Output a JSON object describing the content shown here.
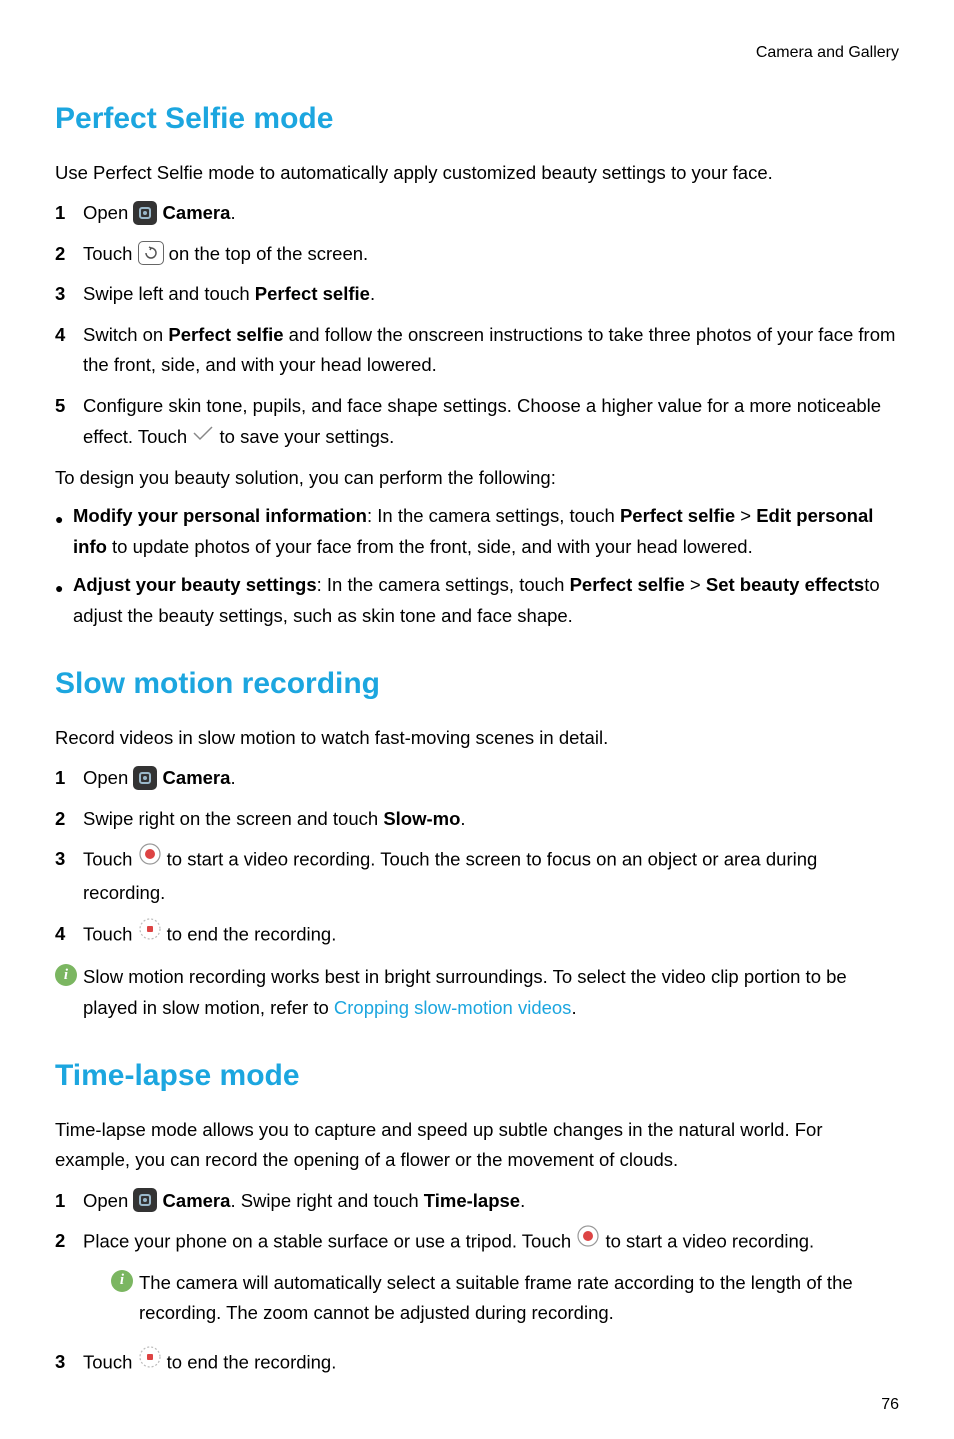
{
  "header": "Camera and Gallery",
  "page_number": "76",
  "sec1": {
    "title": "Perfect Selfie mode",
    "intro": "Use Perfect Selfie mode to automatically apply customized beauty settings to your face.",
    "s1a": "Open ",
    "s1b": "Camera",
    "s1c": ".",
    "s2a": "Touch ",
    "s2b": " on the top of the screen.",
    "s3a": "Swipe left and touch ",
    "s3b": "Perfect selfie",
    "s3c": ".",
    "s4a": "Switch on ",
    "s4b": "Perfect selfie",
    "s4c": " and follow the onscreen instructions to take three photos of your face from the front, side, and with your head lowered.",
    "s5a": "Configure skin tone, pupils, and face shape settings. Choose a higher value for a more noticeable effect. Touch ",
    "s5b": " to save your settings.",
    "post": "To design you beauty solution, you can perform the following:",
    "b1a": "Modify your personal information",
    "b1b": ": In the camera settings, touch ",
    "b1c": "Perfect selfie",
    "b1d": " > ",
    "b1e": "Edit personal info",
    "b1f": " to update photos of your face from the front, side, and with your head lowered.",
    "b2a": "Adjust your beauty settings",
    "b2b": ": In the camera settings, touch ",
    "b2c": "Perfect selfie",
    "b2d": " > ",
    "b2e": "Set beauty effects",
    "b2f": "to adjust the beauty settings, such as skin tone and face shape."
  },
  "sec2": {
    "title": "Slow motion recording",
    "intro": "Record videos in slow motion to watch fast-moving scenes in detail.",
    "s1a": "Open ",
    "s1b": "Camera",
    "s1c": ".",
    "s2a": "Swipe right on the screen and touch ",
    "s2b": "Slow-mo",
    "s2c": ".",
    "s3a": "Touch ",
    "s3b": " to start a video recording. Touch the screen to focus on an object or area during recording.",
    "s4a": "Touch ",
    "s4b": " to end the recording.",
    "note1": "Slow motion recording works best in bright surroundings. To select the video clip portion to be played in slow motion, refer to ",
    "note2": "Cropping slow-motion videos",
    "note3": "."
  },
  "sec3": {
    "title": "Time-lapse mode",
    "intro": "Time-lapse mode allows you to capture and speed up subtle changes in the natural world. For example, you can record the opening of a flower or the movement of clouds.",
    "s1a": "Open ",
    "s1b": "Camera",
    "s1c": ". Swipe right and touch ",
    "s1d": "Time-lapse",
    "s1e": ".",
    "s2a": "Place your phone on a stable surface or use a tripod. Touch ",
    "s2b": " to start a video recording.",
    "note": "The camera will automatically select a suitable frame rate according to the length of the recording. The zoom cannot be adjusted during recording.",
    "s3a": "Touch ",
    "s3b": " to end the recording."
  }
}
